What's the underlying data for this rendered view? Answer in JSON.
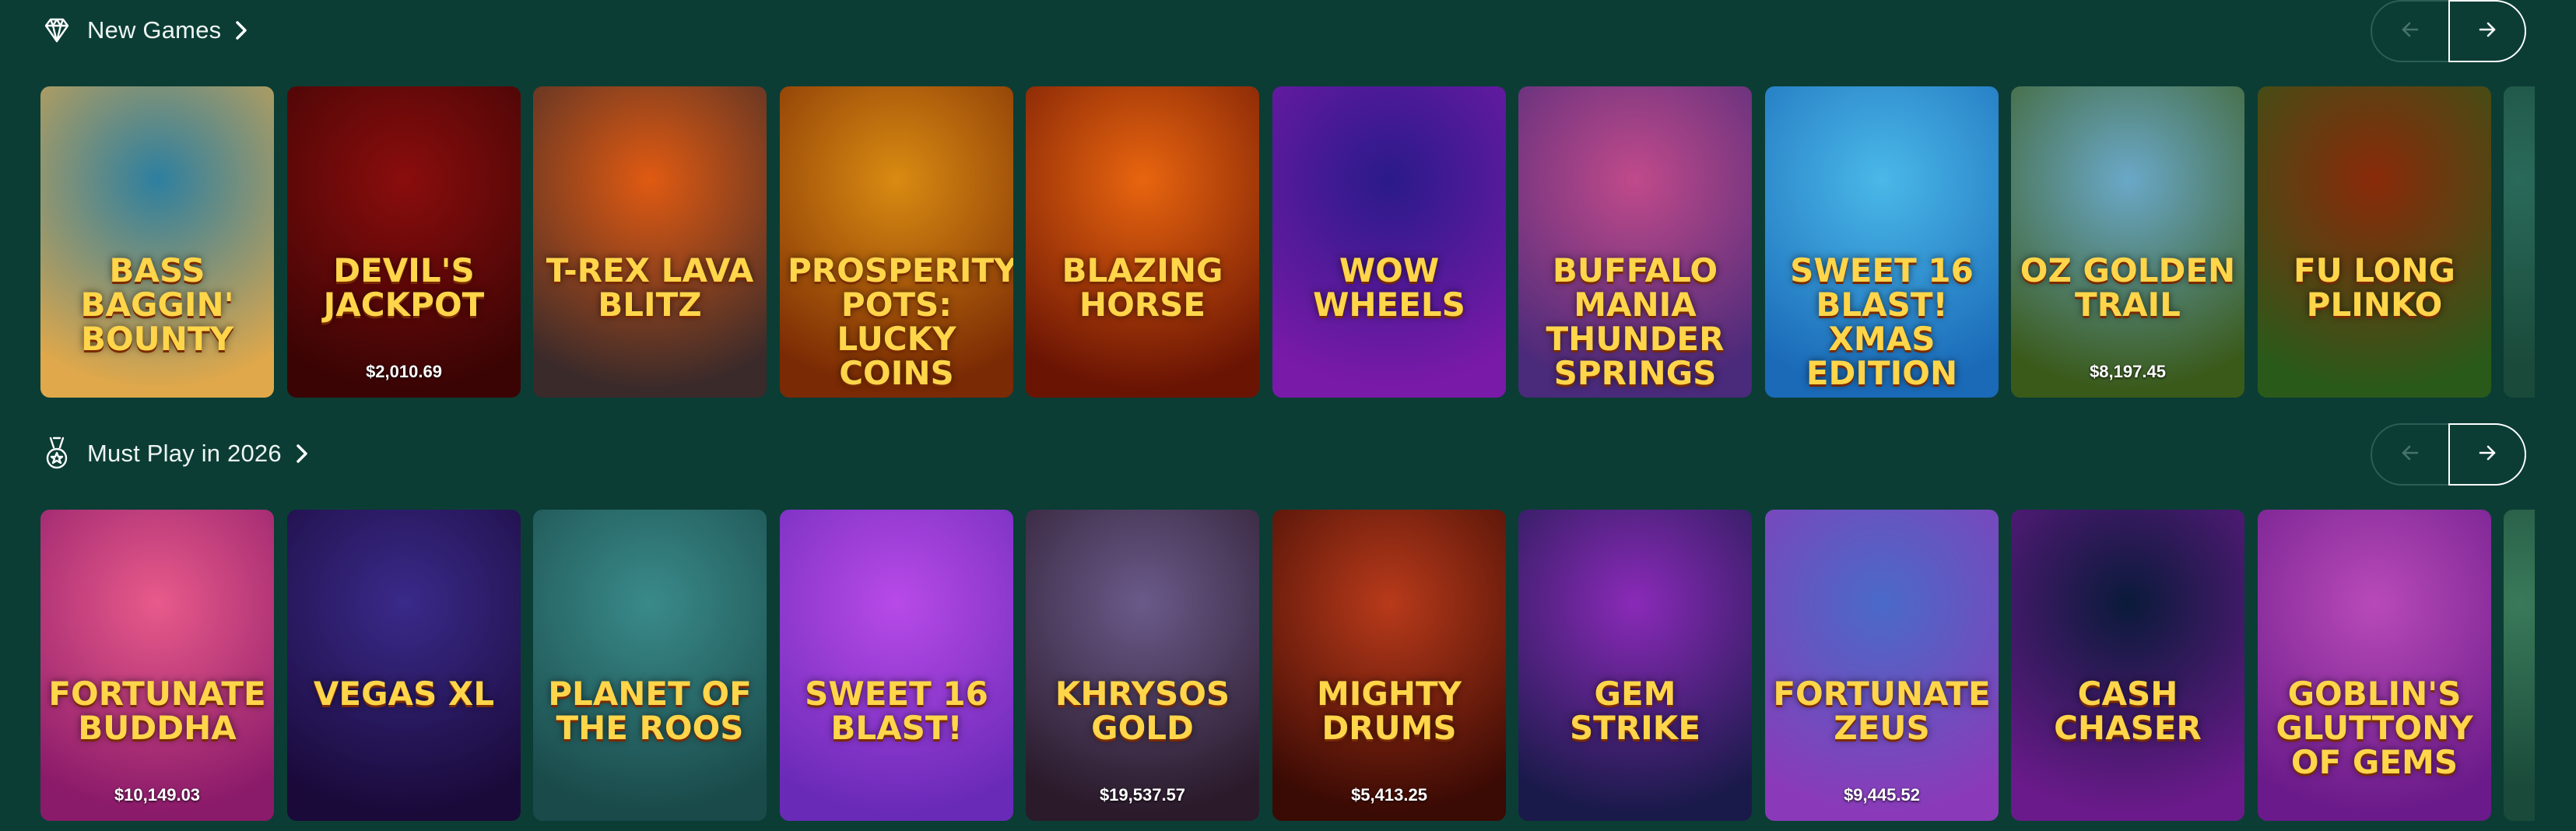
{
  "sections": [
    {
      "title": "New Games",
      "icon": "diamond-icon",
      "nav": {
        "prev": "arrow-left-icon",
        "next": "arrow-right-icon"
      },
      "games": [
        {
          "name": "Bass Baggin' Bounty",
          "jackpot": "",
          "bg": [
            "#2d7fa0",
            "#e0a84a"
          ]
        },
        {
          "name": "Devil's Jackpot",
          "jackpot": "$2,010.69",
          "bg": [
            "#8a0d0d",
            "#3a0404"
          ]
        },
        {
          "name": "T-Rex Lava Blitz",
          "jackpot": "",
          "bg": [
            "#e05a12",
            "#3a2a2a"
          ]
        },
        {
          "name": "Prosperity Pots: Lucky Coins",
          "jackpot": "",
          "bg": [
            "#d98b12",
            "#7a2a04"
          ]
        },
        {
          "name": "Blazing Horse",
          "jackpot": "",
          "bg": [
            "#e8650f",
            "#6a1404"
          ]
        },
        {
          "name": "Wow Wheels",
          "jackpot": "",
          "bg": [
            "#2a1a8a",
            "#7a1aa8"
          ]
        },
        {
          "name": "Buffalo Mania Thunder Springs",
          "jackpot": "",
          "bg": [
            "#c04a8a",
            "#4a2a7a"
          ]
        },
        {
          "name": "Sweet 16 Blast! Xmas Edition",
          "jackpot": "",
          "bg": [
            "#4ab8e8",
            "#1a6ab8"
          ]
        },
        {
          "name": "Oz Golden Trail",
          "jackpot": "$8,197.45",
          "bg": [
            "#6aa8c8",
            "#3a5a1a"
          ]
        },
        {
          "name": "Fu Long Plinko",
          "jackpot": "",
          "bg": [
            "#8a2a0a",
            "#2a5a1a"
          ]
        },
        {
          "name": "",
          "jackpot": "",
          "bg": [
            "#2a6a5a",
            "#1a4a3a"
          ]
        }
      ]
    },
    {
      "title": "Must Play in 2026",
      "icon": "medal-icon",
      "nav": {
        "prev": "arrow-left-icon",
        "next": "arrow-right-icon"
      },
      "games": [
        {
          "name": "Fortunate Buddha",
          "jackpot": "$10,149.03",
          "bg": [
            "#e85a8a",
            "#8a1a6a"
          ]
        },
        {
          "name": "Vegas XL",
          "jackpot": "",
          "bg": [
            "#3a2a8a",
            "#1a0a3a"
          ]
        },
        {
          "name": "Planet of the Roos",
          "jackpot": "",
          "bg": [
            "#3a8a8a",
            "#1a4a4a"
          ]
        },
        {
          "name": "Sweet 16 Blast!",
          "jackpot": "",
          "bg": [
            "#b84ae8",
            "#6a2ab8"
          ]
        },
        {
          "name": "Khrysos Gold",
          "jackpot": "$19,537.57",
          "bg": [
            "#6a5a8a",
            "#2a1a2a"
          ]
        },
        {
          "name": "Mighty Drums",
          "jackpot": "$5,413.25",
          "bg": [
            "#b83a1a",
            "#3a0a04"
          ]
        },
        {
          "name": "Gem Strike",
          "jackpot": "",
          "bg": [
            "#8a2ab8",
            "#1a1a4a"
          ]
        },
        {
          "name": "Fortunate Zeus",
          "jackpot": "$9,445.52",
          "bg": [
            "#4a6ac8",
            "#8a3ab8"
          ]
        },
        {
          "name": "Cash Chaser",
          "jackpot": "",
          "bg": [
            "#0a1a3a",
            "#6a1a8a"
          ]
        },
        {
          "name": "Goblin's Gluttony of Gems",
          "jackpot": "",
          "bg": [
            "#b84ab8",
            "#6a1a8a"
          ]
        },
        {
          "name": "",
          "jackpot": "",
          "bg": [
            "#3a7a5a",
            "#1a4a3a"
          ]
        }
      ]
    }
  ]
}
